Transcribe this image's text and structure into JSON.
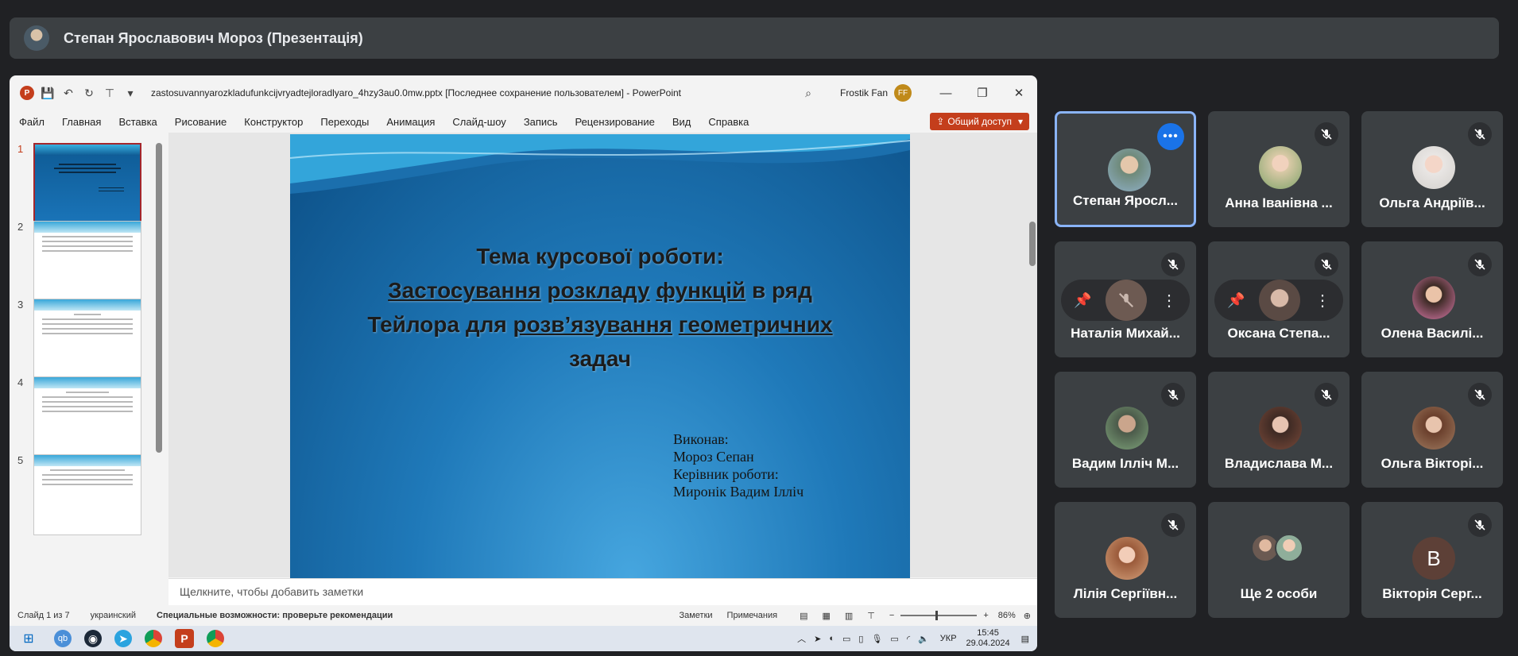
{
  "meet": {
    "presenter_title": "Степан Ярославович Мороз (Презентація)"
  },
  "ppt": {
    "filename": "zastosuvannyarozkladufunkcijvryadtejloradlyaro_4hzy3au0.0mw.pptx [Последнее сохранение пользователем]  -  PowerPoint",
    "user_name": "Frostik Fan",
    "user_initials": "FF",
    "menu": [
      "Файл",
      "Главная",
      "Вставка",
      "Рисование",
      "Конструктор",
      "Переходы",
      "Анимация",
      "Слайд-шоу",
      "Запись",
      "Рецензирование",
      "Вид",
      "Справка"
    ],
    "share_label": "Общий доступ",
    "thumb_numbers": [
      "1",
      "2",
      "3",
      "4",
      "5"
    ],
    "slide": {
      "title_l1": "Тема курсової роботи:",
      "title_l2a": "Застосування",
      "title_l2b": " ",
      "title_l2c": "розкладу",
      "title_l2d": " ",
      "title_l2e": "функцій",
      "title_l2f": " в ряд",
      "title_l3a": "Тейлора для ",
      "title_l3b": "розв’язування",
      "title_l3c": " ",
      "title_l3d": "геометричних",
      "title_l4": "задач",
      "authors": [
        "Виконав:",
        "Мороз Сепан",
        "Керівник роботи:",
        "Миронік Вадим Ілліч"
      ]
    },
    "notes_placeholder": "Щелкните, чтобы добавить заметки",
    "status": {
      "slide_of": "Слайд 1 из 7",
      "language": "украинский",
      "accessibility": "Специальные возможности: проверьте рекомендации",
      "notes_btn": "Заметки",
      "comments_btn": "Примечания",
      "zoom": "86%"
    }
  },
  "taskbar": {
    "lang": "УКР",
    "time": "15:45",
    "date": "29.04.2024"
  },
  "participants": [
    {
      "name": "Степан Яросл...",
      "muted": false,
      "active": true
    },
    {
      "name": "Анна Іванівна ...",
      "muted": true
    },
    {
      "name": "Ольга Андріїв...",
      "muted": true
    },
    {
      "name": "Наталія Михай...",
      "muted": true
    },
    {
      "name": "Оксана Степа...",
      "muted": true
    },
    {
      "name": "Олена Василі...",
      "muted": true
    },
    {
      "name": "Вадим Ілліч М...",
      "muted": true
    },
    {
      "name": "Владислава М...",
      "muted": true
    },
    {
      "name": "Ольга Вікторі...",
      "muted": true
    },
    {
      "name": "Лілія Сергіївн...",
      "muted": true
    },
    {
      "name": "Ще 2 особи",
      "muted": false
    },
    {
      "name": "Вікторія Серг...",
      "muted": true,
      "initial": "В"
    }
  ]
}
